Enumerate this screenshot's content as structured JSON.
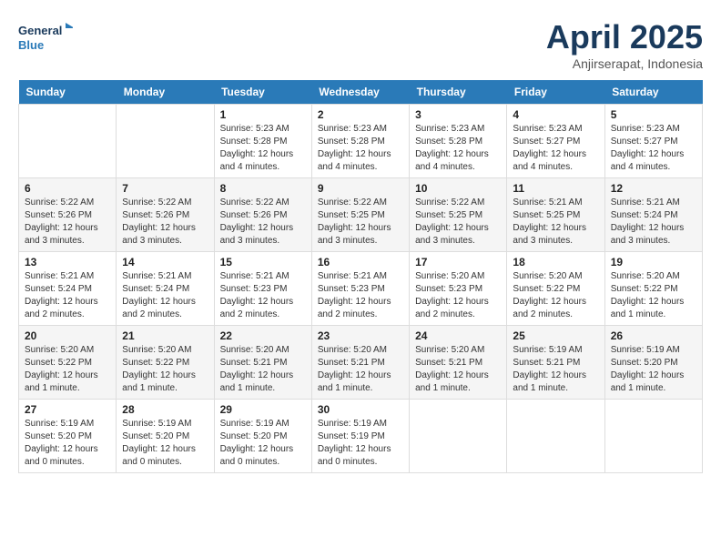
{
  "header": {
    "logo_line1": "General",
    "logo_line2": "Blue",
    "title": "April 2025",
    "subtitle": "Anjirserapat, Indonesia"
  },
  "days_of_week": [
    "Sunday",
    "Monday",
    "Tuesday",
    "Wednesday",
    "Thursday",
    "Friday",
    "Saturday"
  ],
  "weeks": [
    [
      {
        "day": "",
        "info": ""
      },
      {
        "day": "",
        "info": ""
      },
      {
        "day": "1",
        "info": "Sunrise: 5:23 AM\nSunset: 5:28 PM\nDaylight: 12 hours and 4 minutes."
      },
      {
        "day": "2",
        "info": "Sunrise: 5:23 AM\nSunset: 5:28 PM\nDaylight: 12 hours and 4 minutes."
      },
      {
        "day": "3",
        "info": "Sunrise: 5:23 AM\nSunset: 5:28 PM\nDaylight: 12 hours and 4 minutes."
      },
      {
        "day": "4",
        "info": "Sunrise: 5:23 AM\nSunset: 5:27 PM\nDaylight: 12 hours and 4 minutes."
      },
      {
        "day": "5",
        "info": "Sunrise: 5:23 AM\nSunset: 5:27 PM\nDaylight: 12 hours and 4 minutes."
      }
    ],
    [
      {
        "day": "6",
        "info": "Sunrise: 5:22 AM\nSunset: 5:26 PM\nDaylight: 12 hours and 3 minutes."
      },
      {
        "day": "7",
        "info": "Sunrise: 5:22 AM\nSunset: 5:26 PM\nDaylight: 12 hours and 3 minutes."
      },
      {
        "day": "8",
        "info": "Sunrise: 5:22 AM\nSunset: 5:26 PM\nDaylight: 12 hours and 3 minutes."
      },
      {
        "day": "9",
        "info": "Sunrise: 5:22 AM\nSunset: 5:25 PM\nDaylight: 12 hours and 3 minutes."
      },
      {
        "day": "10",
        "info": "Sunrise: 5:22 AM\nSunset: 5:25 PM\nDaylight: 12 hours and 3 minutes."
      },
      {
        "day": "11",
        "info": "Sunrise: 5:21 AM\nSunset: 5:25 PM\nDaylight: 12 hours and 3 minutes."
      },
      {
        "day": "12",
        "info": "Sunrise: 5:21 AM\nSunset: 5:24 PM\nDaylight: 12 hours and 3 minutes."
      }
    ],
    [
      {
        "day": "13",
        "info": "Sunrise: 5:21 AM\nSunset: 5:24 PM\nDaylight: 12 hours and 2 minutes."
      },
      {
        "day": "14",
        "info": "Sunrise: 5:21 AM\nSunset: 5:24 PM\nDaylight: 12 hours and 2 minutes."
      },
      {
        "day": "15",
        "info": "Sunrise: 5:21 AM\nSunset: 5:23 PM\nDaylight: 12 hours and 2 minutes."
      },
      {
        "day": "16",
        "info": "Sunrise: 5:21 AM\nSunset: 5:23 PM\nDaylight: 12 hours and 2 minutes."
      },
      {
        "day": "17",
        "info": "Sunrise: 5:20 AM\nSunset: 5:23 PM\nDaylight: 12 hours and 2 minutes."
      },
      {
        "day": "18",
        "info": "Sunrise: 5:20 AM\nSunset: 5:22 PM\nDaylight: 12 hours and 2 minutes."
      },
      {
        "day": "19",
        "info": "Sunrise: 5:20 AM\nSunset: 5:22 PM\nDaylight: 12 hours and 1 minute."
      }
    ],
    [
      {
        "day": "20",
        "info": "Sunrise: 5:20 AM\nSunset: 5:22 PM\nDaylight: 12 hours and 1 minute."
      },
      {
        "day": "21",
        "info": "Sunrise: 5:20 AM\nSunset: 5:22 PM\nDaylight: 12 hours and 1 minute."
      },
      {
        "day": "22",
        "info": "Sunrise: 5:20 AM\nSunset: 5:21 PM\nDaylight: 12 hours and 1 minute."
      },
      {
        "day": "23",
        "info": "Sunrise: 5:20 AM\nSunset: 5:21 PM\nDaylight: 12 hours and 1 minute."
      },
      {
        "day": "24",
        "info": "Sunrise: 5:20 AM\nSunset: 5:21 PM\nDaylight: 12 hours and 1 minute."
      },
      {
        "day": "25",
        "info": "Sunrise: 5:19 AM\nSunset: 5:21 PM\nDaylight: 12 hours and 1 minute."
      },
      {
        "day": "26",
        "info": "Sunrise: 5:19 AM\nSunset: 5:20 PM\nDaylight: 12 hours and 1 minute."
      }
    ],
    [
      {
        "day": "27",
        "info": "Sunrise: 5:19 AM\nSunset: 5:20 PM\nDaylight: 12 hours and 0 minutes."
      },
      {
        "day": "28",
        "info": "Sunrise: 5:19 AM\nSunset: 5:20 PM\nDaylight: 12 hours and 0 minutes."
      },
      {
        "day": "29",
        "info": "Sunrise: 5:19 AM\nSunset: 5:20 PM\nDaylight: 12 hours and 0 minutes."
      },
      {
        "day": "30",
        "info": "Sunrise: 5:19 AM\nSunset: 5:19 PM\nDaylight: 12 hours and 0 minutes."
      },
      {
        "day": "",
        "info": ""
      },
      {
        "day": "",
        "info": ""
      },
      {
        "day": "",
        "info": ""
      }
    ]
  ]
}
